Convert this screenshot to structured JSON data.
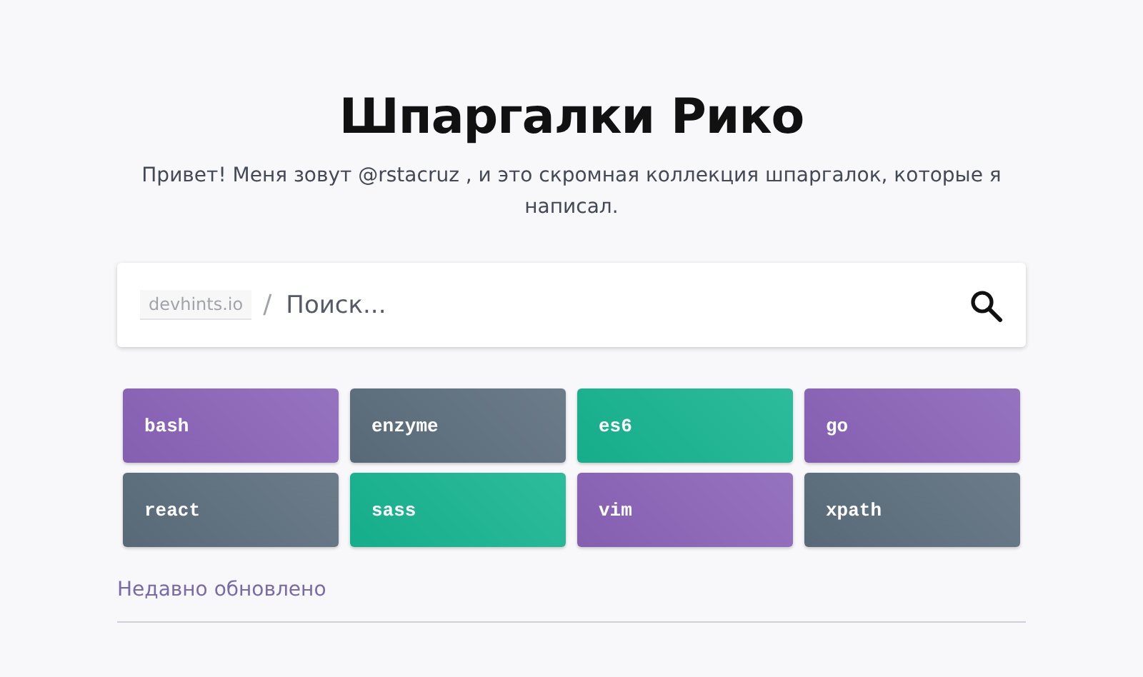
{
  "title": "Шпаргалки Рико",
  "intro": {
    "before": "Привет! Меня зовут",
    "link": "@rstacruz",
    "after": ", и это скромная коллекция шпаргалок, которые я написал."
  },
  "search": {
    "site": "devhints.io",
    "separator": "/",
    "placeholder": "Поиск..."
  },
  "sheets": [
    {
      "label": "bash",
      "color": "#8a63b8"
    },
    {
      "label": "enzyme",
      "color": "#5b6d7c"
    },
    {
      "label": "es6",
      "color": "#16b490"
    },
    {
      "label": "go",
      "color": "#8a63b8"
    },
    {
      "label": "react",
      "color": "#5b6d7c"
    },
    {
      "label": "sass",
      "color": "#16b490"
    },
    {
      "label": "vim",
      "color": "#8a63b8"
    },
    {
      "label": "xpath",
      "color": "#5b6d7c"
    }
  ],
  "section_heading": "Недавно обновлено"
}
